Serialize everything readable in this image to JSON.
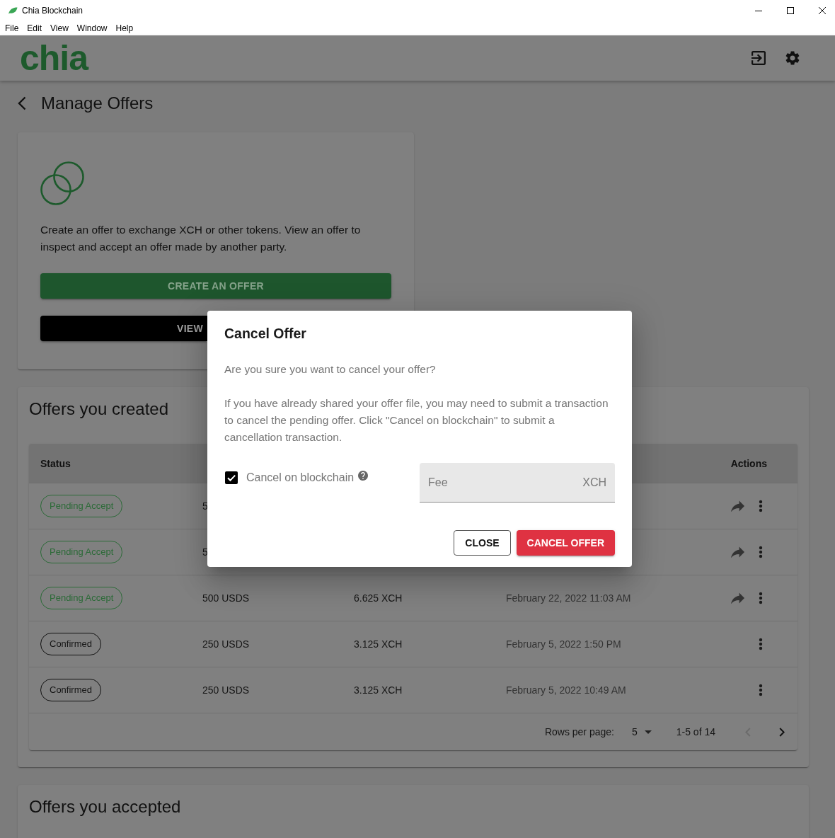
{
  "window": {
    "title": "Chia Blockchain",
    "menu": [
      "File",
      "Edit",
      "View",
      "Window",
      "Help"
    ]
  },
  "app_bar": {
    "logo": "chia"
  },
  "page": {
    "title": "Manage Offers"
  },
  "intro_card": {
    "text": "Create an offer to exchange XCH or other tokens. View an offer to inspect and accept an offer made by another party.",
    "buttons": [
      {
        "label": "CREATE AN OFFER",
        "kind": "primary"
      },
      {
        "label": "VIEW",
        "kind": "dark"
      }
    ]
  },
  "created_offers": {
    "title": "Offers you created",
    "table": {
      "columns": {
        "status": "Status",
        "actions": "Actions"
      },
      "rows": [
        {
          "status": {
            "label": "Pending Accept",
            "kind": "pending"
          },
          "column_2": "5",
          "share": true
        },
        {
          "status": {
            "label": "Pending Accept",
            "kind": "pending"
          },
          "column_2": "5",
          "share": true
        },
        {
          "status": {
            "label": "Pending Accept",
            "kind": "pending"
          },
          "column_2": "500 USDS",
          "column_3": "6.625 XCH",
          "column_4": "February 22, 2022 11:03 AM",
          "share": true
        },
        {
          "status": {
            "label": "Confirmed",
            "kind": "confirmed"
          },
          "column_2": "250 USDS",
          "column_3": "3.125 XCH",
          "column_4": "February 5, 2022 1:50 PM",
          "share": false
        },
        {
          "status": {
            "label": "Confirmed",
            "kind": "confirmed"
          },
          "column_2": "250 USDS",
          "column_3": "3.125 XCH",
          "column_4": "February 5, 2022 10:49 AM",
          "share": false
        }
      ]
    },
    "pagination": {
      "label": "Rows per page:",
      "rows_per_page": "5",
      "range": "1-5 of 14",
      "prev_disabled": true,
      "next_disabled": false
    }
  },
  "accepted_offers": {
    "title": "Offers you accepted"
  },
  "dialog": {
    "title": "Cancel Offer",
    "paragraphs": [
      "Are you sure you want to cancel your offer?",
      "If you have already shared your offer file, you may need to submit a transaction to cancel the pending offer. Click \"Cancel on blockchain\" to submit a cancellation transaction."
    ],
    "checkbox": {
      "label": "Cancel on blockchain",
      "checked": true
    },
    "fee_field": {
      "placeholder": "Fee",
      "unit": "XCH"
    },
    "buttons": [
      {
        "label": "CLOSE",
        "kind": "outline"
      },
      {
        "label": "CANCEL OFFER",
        "kind": "danger"
      }
    ]
  }
}
